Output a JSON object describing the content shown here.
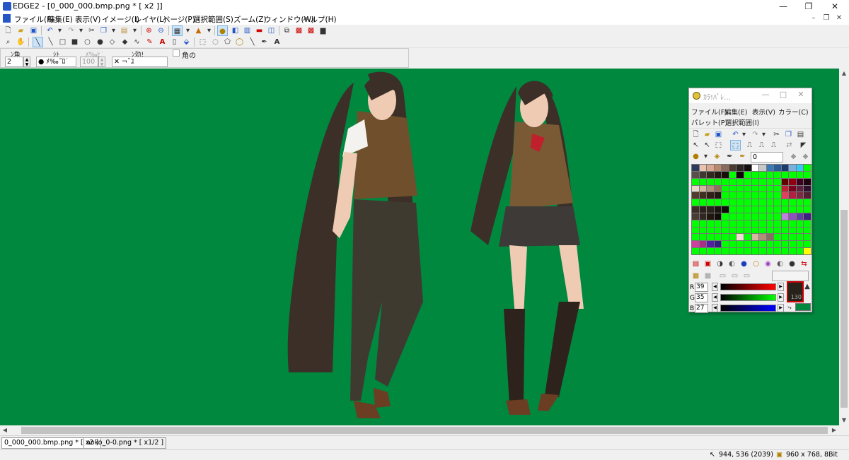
{
  "window": {
    "title": "EDGE2 - [0_000_000.bmp.png * [ x2 ]]",
    "minimize": "—",
    "maximize": "❐",
    "close": "✕"
  },
  "mdi": {
    "minimize": "–",
    "restore": "❐",
    "close": "✕"
  },
  "menu": [
    "ファイル(F)",
    "編集(E)",
    "表示(V)",
    "イメージ(I)",
    "レイヤ(L)",
    "ページ(P)",
    "選択範囲(S)",
    "ズーム(Z)",
    "ウィンドウ(W)",
    "ヘルプ(H)"
  ],
  "options": {
    "width_label": "ﾝ角",
    "width_value": "2",
    "shape_label": "ｼﾄ",
    "shape_value": "● ﾒ‰˝ﾛ˙",
    "density_label": "ﾒ‰ﾋ˙",
    "density_value": "100",
    "effect_label": "ﾝ効!",
    "effect_value": "✕ ¬˘ﾕ",
    "corner_label": "角の"
  },
  "palette": {
    "title": "ｶﾗ!ﾊﾟﾚ…",
    "menu_row1": [
      "ファイル(F)",
      "編集(E)",
      "表示(V)",
      "カラー(C)"
    ],
    "menu_row2": [
      "パレット(P)",
      "選択範囲(I)"
    ],
    "index_value": "0",
    "r_label": "R",
    "r_value": "39",
    "g_label": "G",
    "g_value": "35",
    "b_label": "B",
    "b_value": "27",
    "alpha_value": "130",
    "current_color": "#27231b",
    "rows": [
      [
        "#2d3b5a",
        "#e8c4ae",
        "#d8a890",
        "#b88870",
        "#8a6a5a",
        "#4a3a32",
        "#2c2420",
        "#141010",
        "#ffffff",
        "#c8c8c8",
        "#387ab8",
        "#2a5a98",
        "#1a3a70",
        "#7ab0e0",
        "#38c8f8",
        "#00ff00"
      ],
      [
        "#585048",
        "#403830",
        "#302820",
        "#201810",
        "#181008",
        "#00ff00",
        "#100808",
        "#00ff00",
        "#00ff00",
        "#00ff00",
        "#00ff00",
        "#00ff00",
        "#00ff00",
        "#00ff00",
        "#00ff00",
        "#00ff00"
      ],
      [
        "#00ff00",
        "#00ff00",
        "#00ff00",
        "#00ff00",
        "#00ff00",
        "#00ff00",
        "#00ff00",
        "#00ff00",
        "#00ff00",
        "#00ff00",
        "#00ff00",
        "#00ff00",
        "#600000",
        "#900010",
        "#400020",
        "#200010"
      ],
      [
        "#e8d8c8",
        "#d0b8a0",
        "#b09078",
        "#907058",
        "#00ff00",
        "#00ff00",
        "#00ff00",
        "#00ff00",
        "#00ff00",
        "#00ff00",
        "#00ff00",
        "#00ff00",
        "#c02030",
        "#800020",
        "#602040",
        "#301030"
      ],
      [
        "#503c2c",
        "#403020",
        "#302018",
        "#201810",
        "#00ff00",
        "#00ff00",
        "#00ff00",
        "#00ff00",
        "#00ff00",
        "#00ff00",
        "#00ff00",
        "#00ff00",
        "#e04060",
        "#b02040",
        "#802840",
        "#502030"
      ],
      [
        "#00ff00",
        "#00ff00",
        "#00ff00",
        "#00ff00",
        "#00ff00",
        "#00ff00",
        "#00ff00",
        "#00ff00",
        "#00ff00",
        "#00ff00",
        "#00ff00",
        "#00ff00",
        "#00ff00",
        "#00ff00",
        "#00ff00",
        "#00ff00"
      ],
      [
        "#3a2e26",
        "#2c221c",
        "#27231b",
        "#1a1410",
        "#100c08",
        "#00ff00",
        "#00ff00",
        "#00ff00",
        "#00ff00",
        "#00ff00",
        "#00ff00",
        "#00ff00",
        "#00ff00",
        "#00ff00",
        "#00ff00",
        "#00ff00"
      ],
      [
        "#483c34",
        "#302820",
        "#201810",
        "#100c08",
        "#00ff00",
        "#00ff00",
        "#00ff00",
        "#00ff00",
        "#00ff00",
        "#00ff00",
        "#00ff00",
        "#00ff00",
        "#c080e0",
        "#9050c0",
        "#6040a0",
        "#402080"
      ],
      [
        "#00ff00",
        "#00ff00",
        "#00ff00",
        "#00ff00",
        "#00ff00",
        "#00ff00",
        "#00ff00",
        "#00ff00",
        "#00ff00",
        "#00ff00",
        "#00ff00",
        "#00ff00",
        "#00ff00",
        "#00ff00",
        "#00ff00",
        "#00ff00"
      ],
      [
        "#00ff00",
        "#00ff00",
        "#00ff00",
        "#00ff00",
        "#00ff00",
        "#00ff00",
        "#00ff00",
        "#00ff00",
        "#00ff00",
        "#00ff00",
        "#00ff00",
        "#00ff00",
        "#00ff00",
        "#00ff00",
        "#00ff00",
        "#00ff00"
      ],
      [
        "#00ff00",
        "#00ff00",
        "#00ff00",
        "#00ff00",
        "#00ff00",
        "#00ff00",
        "#f0e0d0",
        "#00ff00",
        "#d8b8a0",
        "#b09078",
        "#887060",
        "#00ff00",
        "#00ff00",
        "#00ff00",
        "#00ff00",
        "#00ff00"
      ],
      [
        "#d040a0",
        "#a83088",
        "#5020a0",
        "#302080",
        "#00ff00",
        "#00ff00",
        "#00ff00",
        "#00ff00",
        "#00ff00",
        "#00ff00",
        "#00ff00",
        "#00ff00",
        "#00ff00",
        "#00ff00",
        "#00ff00",
        "#00ff00"
      ],
      [
        "#00ff00",
        "#00ff00",
        "#00ff00",
        "#00ff00",
        "#00ff00",
        "#00ff00",
        "#00ff00",
        "#00ff00",
        "#00ff00",
        "#00ff00",
        "#00ff00",
        "#00ff00",
        "#00ff00",
        "#00ff00",
        "#00ff00",
        "#ffff00"
      ]
    ]
  },
  "tabs": [
    "0_000_000.bmp.png * [ x2 ]",
    "aoko_0-0.png * [ x1/2 ]"
  ],
  "status": {
    "coords": "944, 536 (2039)",
    "size": "960 x 768, 8Bit"
  }
}
